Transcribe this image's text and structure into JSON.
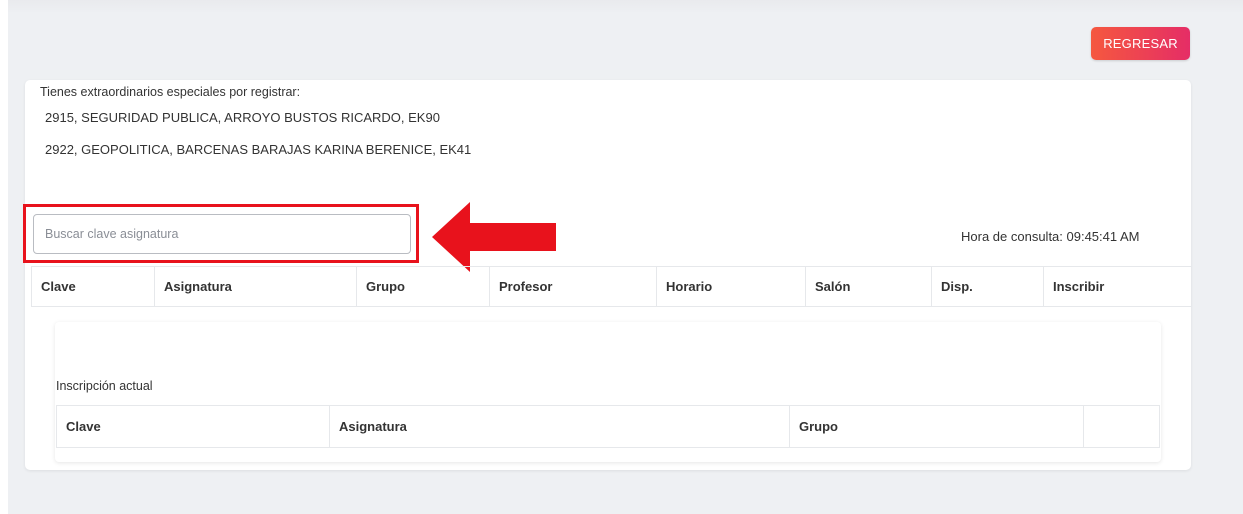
{
  "header": {
    "back_label": "REGRESAR"
  },
  "notice": {
    "title": "Tienes extraordinarios especiales por registrar:",
    "items": [
      "2915, SEGURIDAD PUBLICA, ARROYO BUSTOS RICARDO, EK90",
      "2922, GEOPOLITICA, BARCENAS BARAJAS KARINA BERENICE, EK41"
    ]
  },
  "search": {
    "placeholder": "Buscar clave asignatura",
    "value": ""
  },
  "query_time": "Hora de consulta: 09:45:41 AM",
  "offer_table": {
    "columns": [
      "Clave",
      "Asignatura",
      "Grupo",
      "Profesor",
      "Horario",
      "Salón",
      "Disp.",
      "Inscribir"
    ]
  },
  "current": {
    "title": "Inscripción actual",
    "columns": [
      "Clave",
      "Asignatura",
      "Grupo",
      ""
    ]
  },
  "colors": {
    "accent_gradient_start": "#f5583f",
    "accent_gradient_end": "#e52d66",
    "highlight": "#e8121c"
  },
  "annotation": {
    "arrow_icon": "left-arrow-icon"
  }
}
